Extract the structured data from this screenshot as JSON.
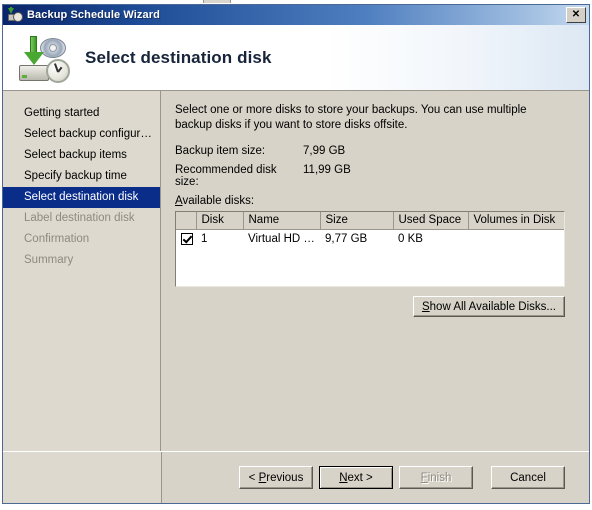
{
  "window": {
    "title": "Backup Schedule Wizard",
    "title_icon": "backup-schedule-icon",
    "close_label": "✕"
  },
  "banner": {
    "heading": "Select destination disk",
    "icon": "disk-clock-arrow-icon"
  },
  "sidebar": {
    "items": [
      {
        "label": "Getting started",
        "state": "done"
      },
      {
        "label": "Select backup configur…",
        "state": "done"
      },
      {
        "label": "Select backup items",
        "state": "done"
      },
      {
        "label": "Specify backup time",
        "state": "done"
      },
      {
        "label": "Select destination disk",
        "state": "active"
      },
      {
        "label": "Label destination disk",
        "state": "disabled"
      },
      {
        "label": "Confirmation",
        "state": "disabled"
      },
      {
        "label": "Summary",
        "state": "disabled"
      }
    ]
  },
  "content": {
    "instructions": "Select one or more disks to store your backups. You can use multiple backup disks if you want to store disks offsite.",
    "stats": [
      {
        "label": "Backup item size:",
        "value": "7,99 GB"
      },
      {
        "label": "Recommended disk size:",
        "value": "11,99 GB"
      }
    ],
    "available_disks_label": "Available disks:",
    "available_disks_mnemonic": "A",
    "table": {
      "columns": [
        "",
        "Disk",
        "Name",
        "Size",
        "Used Space",
        "Volumes in Disk"
      ],
      "rows": [
        {
          "selected": true,
          "disk": "1",
          "name": "Virtual HD …",
          "size": "9,77 GB",
          "used_space": "0 KB",
          "volumes_in_disk": ""
        }
      ]
    },
    "show_all_button": {
      "label": "Show All Available Disks...",
      "mnemonic": "S"
    }
  },
  "footer": {
    "buttons": [
      {
        "id": "previous",
        "label": "< Previous",
        "mnemonic": "P",
        "enabled": true,
        "default": false
      },
      {
        "id": "next",
        "label": "Next >",
        "mnemonic": "N",
        "enabled": true,
        "default": true
      },
      {
        "id": "finish",
        "label": "Finish",
        "mnemonic": "F",
        "enabled": false,
        "default": false
      },
      {
        "id": "cancel",
        "label": "Cancel",
        "mnemonic": "",
        "enabled": true,
        "default": false
      }
    ]
  },
  "colors": {
    "titlebar_start": "#0a246a",
    "titlebar_end": "#c8dcf0",
    "dialog_face": "#d7d3c8",
    "sidebar_face": "#ddd9ce",
    "selection": "#0b2d8a",
    "disabled_text": "#8e8a80"
  }
}
